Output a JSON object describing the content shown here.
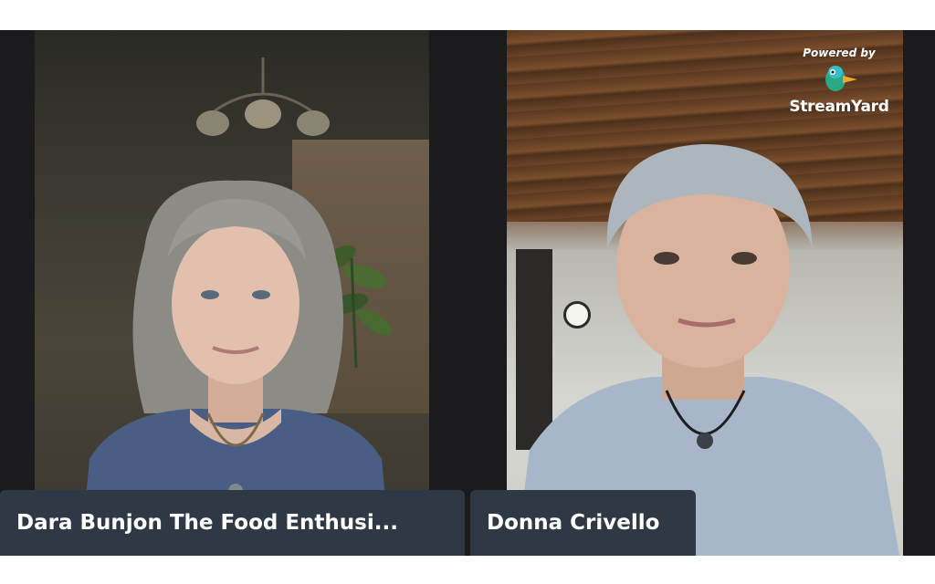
{
  "participants": [
    {
      "name": "Dara Bunjon The Food Enthusi..."
    },
    {
      "name": "Donna Crivello"
    }
  ],
  "branding": {
    "powered_by": "Powered by",
    "brand_name": "StreamYard",
    "logo_icon": "duck-logo-icon"
  },
  "colors": {
    "stage_background": "#1b1b1d",
    "name_badge_background": "#2f3945",
    "name_badge_text": "#ffffff"
  }
}
